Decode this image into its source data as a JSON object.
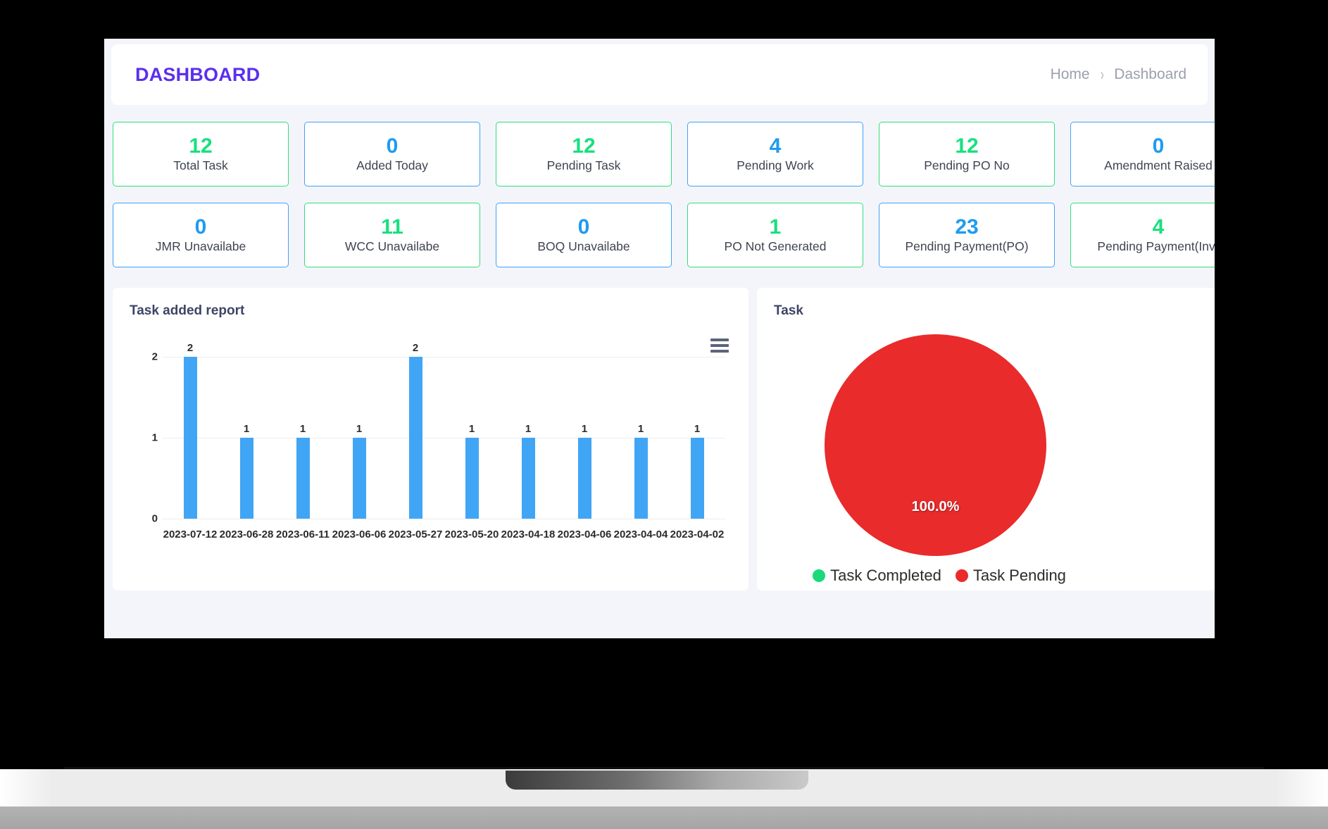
{
  "header": {
    "title": "DASHBOARD",
    "breadcrumb": {
      "home": "Home",
      "separator": "›",
      "current": "Dashboard"
    }
  },
  "colors": {
    "brand_purple": "#5b2fee",
    "accent_green": "#19e07e",
    "accent_blue": "#1f9bf0",
    "bar_blue": "#41a5f5",
    "pie_red": "#e92b2b",
    "pie_green": "#19d97b",
    "panel_title": "#3d4465"
  },
  "stats": {
    "row1": [
      {
        "value": "12",
        "label": "Total Task",
        "color": "green"
      },
      {
        "value": "0",
        "label": "Added Today",
        "color": "blue"
      },
      {
        "value": "12",
        "label": "Pending Task",
        "color": "green"
      },
      {
        "value": "4",
        "label": "Pending Work",
        "color": "blue"
      },
      {
        "value": "12",
        "label": "Pending PO No",
        "color": "green"
      },
      {
        "value": "0",
        "label": "Amendment Raised",
        "color": "blue"
      }
    ],
    "row2": [
      {
        "value": "0",
        "label": "JMR Unavailabe",
        "color": "blue"
      },
      {
        "value": "11",
        "label": "WCC Unavailabe",
        "color": "green"
      },
      {
        "value": "0",
        "label": "BOQ Unavailabe",
        "color": "blue"
      },
      {
        "value": "1",
        "label": "PO Not Generated",
        "color": "green"
      },
      {
        "value": "23",
        "label": "Pending Payment(PO)",
        "color": "blue"
      },
      {
        "value": "4",
        "label": "Pending Payment(Inv)",
        "color": "green"
      }
    ]
  },
  "panels": {
    "bar_panel_title": "Task added report",
    "pie_panel_title": "Task",
    "menu_icon": "hamburger-menu-icon"
  },
  "chart_data": [
    {
      "type": "bar",
      "title": "Task added report",
      "xlabel": "",
      "ylabel": "",
      "ylim": [
        0,
        2
      ],
      "yticks": [
        "0",
        "1",
        "2"
      ],
      "grid": true,
      "legend": "none",
      "categories": [
        "2023-07-12",
        "2023-06-28",
        "2023-06-11",
        "2023-06-06",
        "2023-05-27",
        "2023-05-20",
        "2023-04-18",
        "2023-04-06",
        "2023-04-04",
        "2023-04-02"
      ],
      "values": [
        2,
        1,
        1,
        1,
        2,
        1,
        1,
        1,
        1,
        1
      ],
      "data_labels": [
        "2",
        "1",
        "1",
        "1",
        "2",
        "1",
        "1",
        "1",
        "1",
        "1"
      ],
      "series_color": "#41a5f5"
    },
    {
      "type": "pie",
      "title": "Task",
      "legend": "bottom",
      "labels": [
        "Task Completed",
        "Task Pending"
      ],
      "values": [
        0,
        100
      ],
      "slice_labels": [
        "",
        "100.0%"
      ],
      "visible_slice_label": "100.0%",
      "colors": [
        "#19d97b",
        "#e92b2b"
      ]
    }
  ]
}
